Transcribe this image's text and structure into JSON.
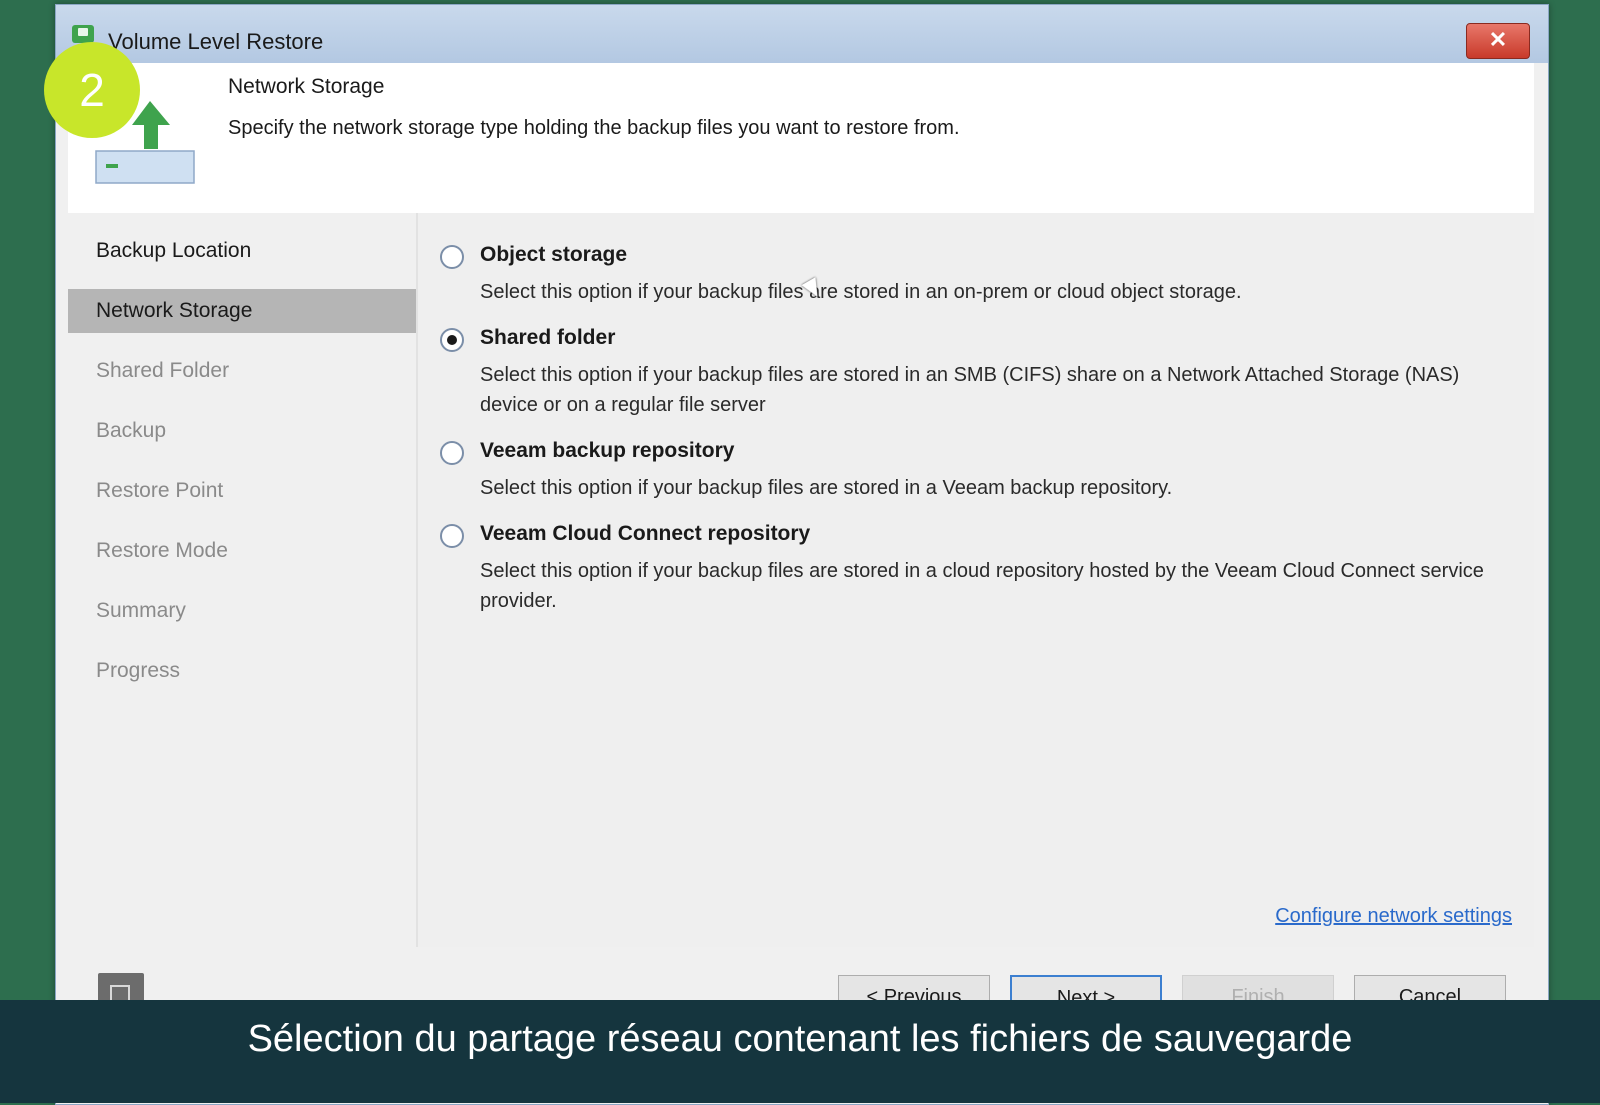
{
  "window": {
    "title": "Volume Level Restore",
    "close_label": "✕"
  },
  "header": {
    "title": "Network Storage",
    "description": "Specify the network storage type holding the backup files you want to restore from."
  },
  "step_badge": "2",
  "nav": {
    "items": [
      {
        "label": "Backup Location",
        "state": "done"
      },
      {
        "label": "Network Storage",
        "state": "active"
      },
      {
        "label": "Shared Folder",
        "state": "pending"
      },
      {
        "label": "Backup",
        "state": "pending"
      },
      {
        "label": "Restore Point",
        "state": "pending"
      },
      {
        "label": "Restore Mode",
        "state": "pending"
      },
      {
        "label": "Summary",
        "state": "pending"
      },
      {
        "label": "Progress",
        "state": "pending"
      }
    ]
  },
  "options": [
    {
      "label": "Object storage",
      "description": "Select this option if your backup files are stored in an on-prem or cloud object storage.",
      "checked": false
    },
    {
      "label": "Shared folder",
      "description": "Select this option if your backup files are stored in an SMB (CIFS) share on a Network Attached Storage (NAS) device or on a regular file server",
      "checked": true
    },
    {
      "label": "Veeam backup repository",
      "description": "Select this option if your backup files are stored in a Veeam backup repository.",
      "checked": false
    },
    {
      "label": "Veeam Cloud Connect repository",
      "description": "Select this option if your backup files are stored in a cloud repository hosted by the Veeam Cloud Connect service provider.",
      "checked": false
    }
  ],
  "configure_link": "Configure network settings",
  "buttons": {
    "previous": "< Previous",
    "next": "Next >",
    "finish": "Finish",
    "cancel": "Cancel"
  },
  "subtitle": "Sélection du partage réseau contenant les fichiers de sauvegarde",
  "colors": {
    "badge": "#c8e62a",
    "subtitle_bar": "#15353e",
    "link": "#2a6acb",
    "nav_active": "#b5b5b5",
    "desktop": "#2d6e4e"
  }
}
